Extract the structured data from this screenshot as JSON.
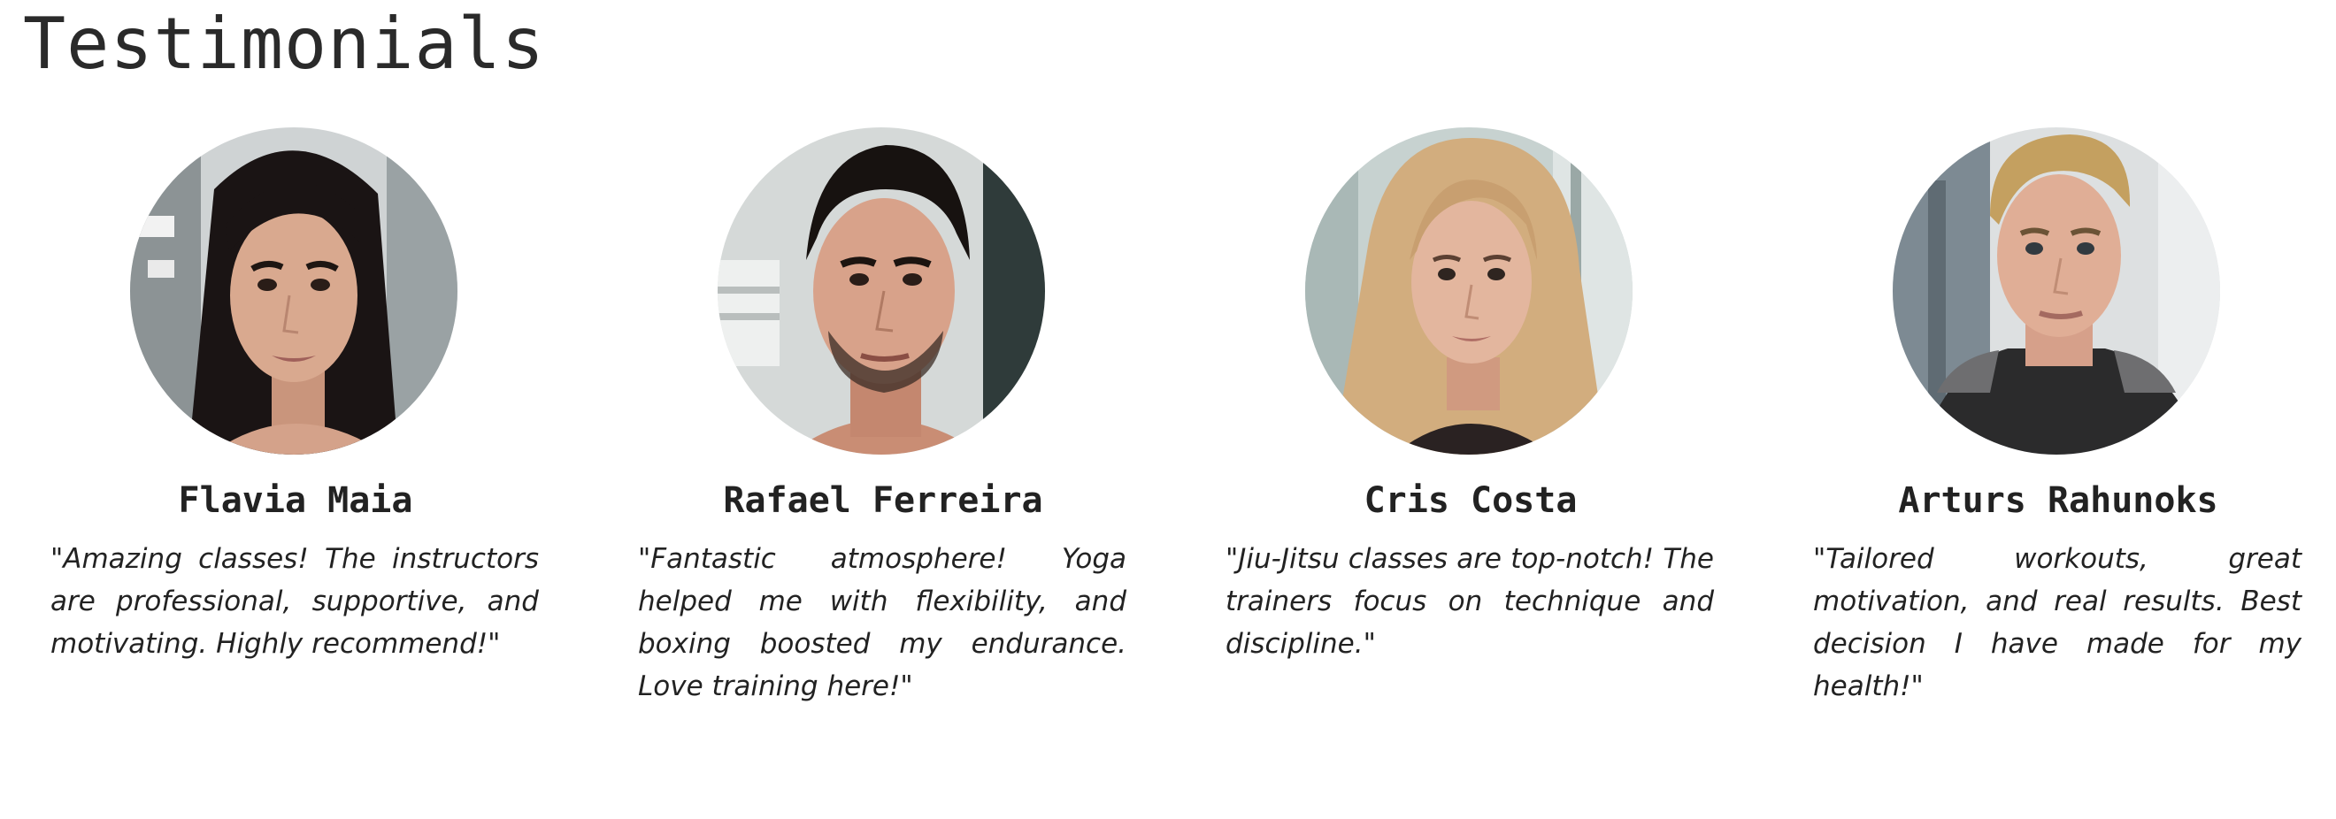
{
  "section": {
    "title": "Testimonials"
  },
  "testimonials": [
    {
      "name": "Flavia Maia",
      "quote": "\"Amazing classes! The instructors are professional, supportive, and motivat­ing. Highly recommend!\"",
      "avatar_icon": "woman-dark-hair-portrait"
    },
    {
      "name": "Rafael Ferreira",
      "quote": "\"Fantastic atmosphere! Yoga helped me with flexibility, and boxing boost­ed my endurance. Love training here!\"",
      "avatar_icon": "man-dark-hair-portrait"
    },
    {
      "name": "Cris Costa",
      "quote": "\"Jiu-Jitsu classes are top-notch! The trainers focus on technique and discipline.\"",
      "avatar_icon": "woman-blonde-hair-portrait"
    },
    {
      "name": "Arturs Rahunoks",
      "quote": "\"Tailored workouts, great motivation, and real results. Best decision I have made for my health!\"",
      "avatar_icon": "man-blonde-hair-portrait"
    }
  ],
  "colors": {
    "background": "#ffffff",
    "text": "#222222"
  }
}
